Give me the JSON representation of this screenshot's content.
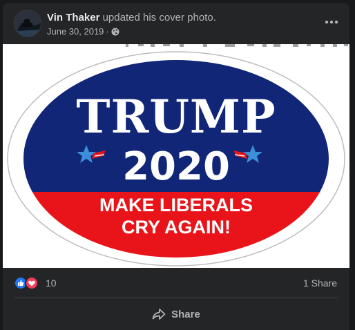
{
  "post": {
    "author_name": "Vin Thaker",
    "action_text": "updated his cover photo.",
    "date": "June 30, 2019",
    "date_separator": "·",
    "privacy_icon": "globe-icon",
    "more_icon": "ellipsis-icon"
  },
  "photo": {
    "line1": "TRUMP",
    "line2": "2020",
    "line3": "MAKE LIBERALS",
    "line4": "CRY AGAIN!",
    "colors": {
      "navy": "#112677",
      "red": "#e8141a",
      "white": "#ffffff",
      "star": "#3a8fd8"
    }
  },
  "reactions": {
    "icons": [
      "like-icon",
      "love-icon"
    ],
    "count": "10",
    "shares": "1 Share"
  },
  "actions": {
    "share_label": "Share",
    "share_icon": "share-arrow-icon"
  },
  "theme": {
    "background": "#18191a",
    "card": "#242526",
    "text_primary": "#e4e6eb",
    "text_secondary": "#b0b3b8",
    "like_blue": "#2078f4",
    "love_red": "#f33e58"
  }
}
